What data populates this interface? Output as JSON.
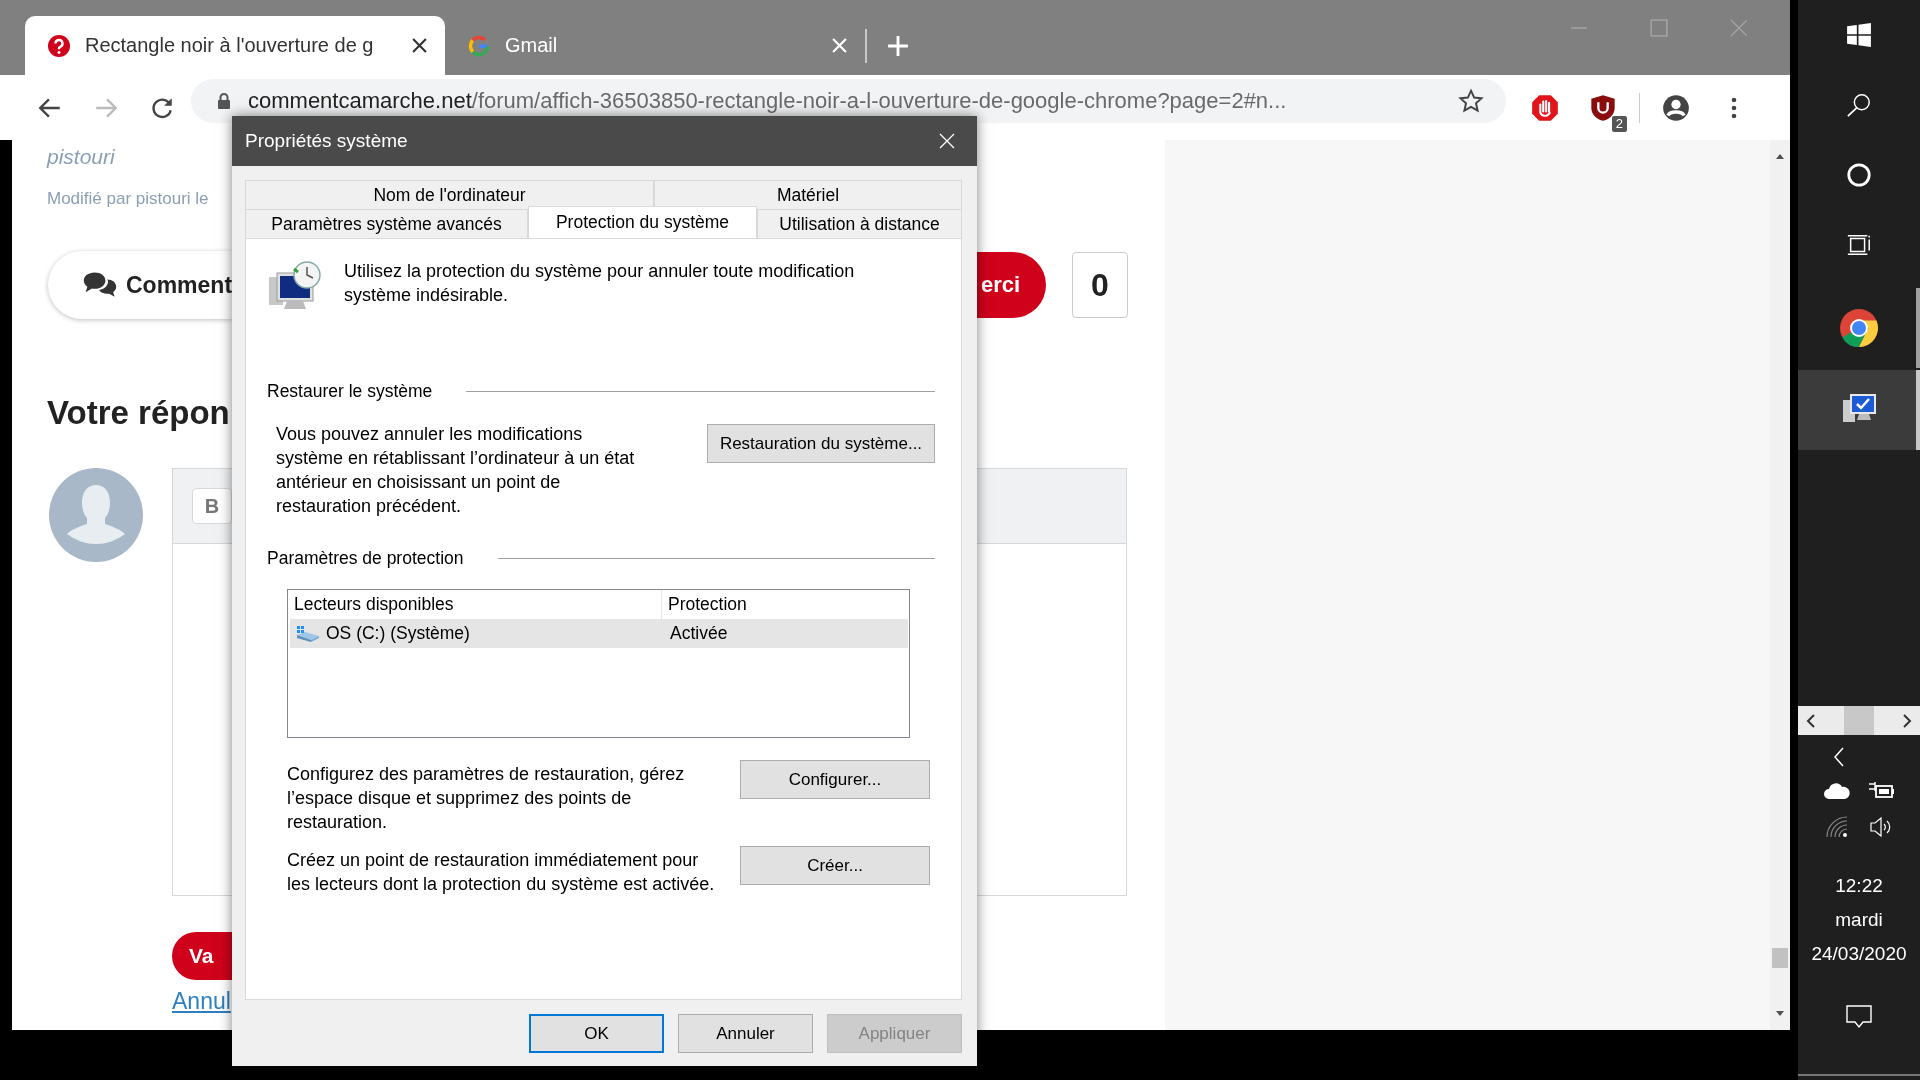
{
  "browser": {
    "tabs": [
      {
        "title": "Rectangle noir à l'ouverture de g",
        "kind": "site",
        "selected": true
      },
      {
        "title": "Gmail",
        "kind": "mail",
        "selected": false
      }
    ],
    "address": {
      "host": "commentcamarche.net",
      "path": "/forum/affich-36503850-rectangle-noir-a-l-ouverture-de-google-chrome?page=2#n..."
    },
    "extension_badge": "2"
  },
  "page": {
    "author": "pistouri",
    "edited": "Modifié par pistouri le",
    "comment_button": "Comment",
    "thanks_button": "erci",
    "thanks_count": "0",
    "reply_heading": "Votre répon",
    "editor_bold_button": "B",
    "submit_button": "Va",
    "cancel_link": "Annul"
  },
  "dialog": {
    "title": "Propriétés système",
    "tab_rows": [
      {
        "tabs": [
          {
            "label": "Nom de l'ordinateur",
            "selected": false
          },
          {
            "label": "Matériel",
            "selected": false
          }
        ]
      },
      {
        "tabs": [
          {
            "label": "Paramètres système avancés",
            "selected": false
          },
          {
            "label": "Protection du système",
            "selected": true
          },
          {
            "label": "Utilisation à distance",
            "selected": false
          }
        ]
      }
    ],
    "intro": "Utilisez la protection du système pour annuler toute modification système indésirable.",
    "restore": {
      "heading": "Restaurer le système",
      "text": "Vous pouvez annuler les modifications système en rétablissant l’ordinateur à un état antérieur en choisissant un point de restauration précédent.",
      "button": "Restauration du système..."
    },
    "protection": {
      "heading": "Paramètres de protection",
      "table": {
        "columns": [
          "Lecteurs disponibles",
          "Protection"
        ],
        "rows": [
          {
            "drive": "OS (C:) (Système)",
            "protection": "Activée",
            "selected": true
          }
        ]
      },
      "actions": [
        {
          "text": "Configurez des paramètres de restauration, gérez l’espace disque et supprimez des points de restauration.",
          "button": "Configurer..."
        },
        {
          "text": "Créez un point de restauration immédiatement pour les lecteurs dont la protection du système est activée.",
          "button": "Créer..."
        }
      ]
    },
    "buttons": [
      {
        "label": "OK",
        "focused": true,
        "disabled": false
      },
      {
        "label": "Annuler",
        "focused": false,
        "disabled": false
      },
      {
        "label": "Appliquer",
        "focused": false,
        "disabled": true
      }
    ]
  },
  "taskbar": {
    "apps": [
      {
        "kind": "browser",
        "active": false
      },
      {
        "kind": "system",
        "active": true
      }
    ],
    "time": "12:22",
    "day": "mardi",
    "date": "24/03/2020"
  }
}
